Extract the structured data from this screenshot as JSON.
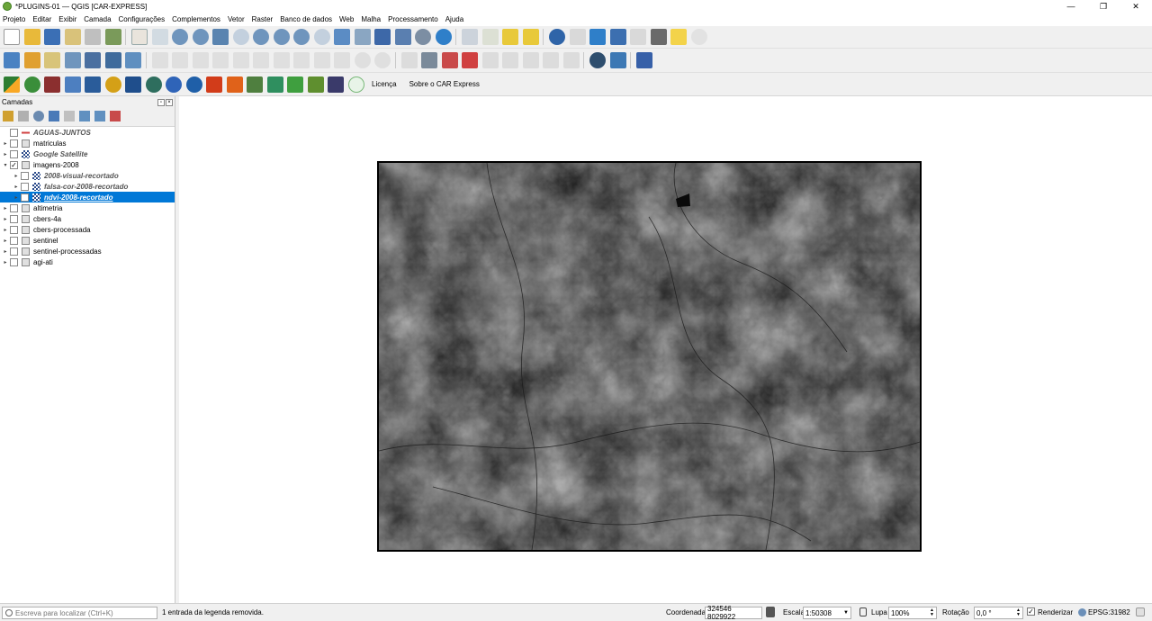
{
  "window": {
    "title": "*PLUGINS-01 — QGIS [CAR-EXPRESS]"
  },
  "menu": [
    "Projeto",
    "Editar",
    "Exibir",
    "Camada",
    "Configurações",
    "Complementos",
    "Vetor",
    "Raster",
    "Banco de dados",
    "Web",
    "Malha",
    "Processamento",
    "Ajuda"
  ],
  "toolbar3_links": {
    "license": "Licença",
    "about": "Sobre o CAR Express"
  },
  "layers_panel": {
    "title": "Camadas",
    "layers": [
      {
        "name": "AGUAS-JUNTOS",
        "checked": false,
        "expander": "",
        "style": "italic",
        "indent": 0,
        "icon": "line-layer-icon"
      },
      {
        "name": "matriculas",
        "checked": false,
        "expander": "▸",
        "style": "normal",
        "indent": 0,
        "icon": "group-icon"
      },
      {
        "name": "Google Satellite",
        "checked": false,
        "expander": "▸",
        "style": "italic",
        "indent": 0,
        "icon": "raster-layer-icon"
      },
      {
        "name": "imagens-2008",
        "checked": true,
        "expander": "▾",
        "style": "normal",
        "indent": 0,
        "icon": "group-icon"
      },
      {
        "name": "2008-visual-recortado",
        "checked": false,
        "expander": "▸",
        "style": "italic",
        "indent": 1,
        "icon": "raster-layer-icon"
      },
      {
        "name": "falsa-cor-2008-recortado",
        "checked": false,
        "expander": "▸",
        "style": "italic",
        "indent": 1,
        "icon": "raster-layer-icon"
      },
      {
        "name": "ndvi-2008-recortado",
        "checked": true,
        "expander": "▸",
        "style": "selected",
        "indent": 1,
        "icon": "raster-layer-icon"
      },
      {
        "name": "altimetria",
        "checked": false,
        "expander": "▸",
        "style": "normal",
        "indent": 0,
        "icon": "group-icon"
      },
      {
        "name": "cbers-4a",
        "checked": false,
        "expander": "▸",
        "style": "normal",
        "indent": 0,
        "icon": "group-icon"
      },
      {
        "name": "cbers-processada",
        "checked": false,
        "expander": "▸",
        "style": "normal",
        "indent": 0,
        "icon": "group-icon"
      },
      {
        "name": "sentinel",
        "checked": false,
        "expander": "▸",
        "style": "normal",
        "indent": 0,
        "icon": "group-icon"
      },
      {
        "name": "sentinel-processadas",
        "checked": false,
        "expander": "▸",
        "style": "normal",
        "indent": 0,
        "icon": "group-icon"
      },
      {
        "name": "agi-ati",
        "checked": false,
        "expander": "▸",
        "style": "normal",
        "indent": 0,
        "icon": "group-icon"
      }
    ]
  },
  "statusbar": {
    "search_placeholder": "Escreva para localizar (Ctrl+K)",
    "message": "1 entrada da legenda removida.",
    "coord_label": "Coordenada",
    "coord_value": "324546  8029922",
    "scale_label": "Escala",
    "scale_value": "1:50308",
    "magnifier_label": "Lupa",
    "magnifier_value": "100%",
    "rotation_label": "Rotação",
    "rotation_value": "0,0 °",
    "render_label": "Renderizar",
    "render_checked": true,
    "crs": "EPSG:31982"
  },
  "colors": {
    "selection": "#0078d7",
    "qgis_green": "#6ba53a"
  }
}
